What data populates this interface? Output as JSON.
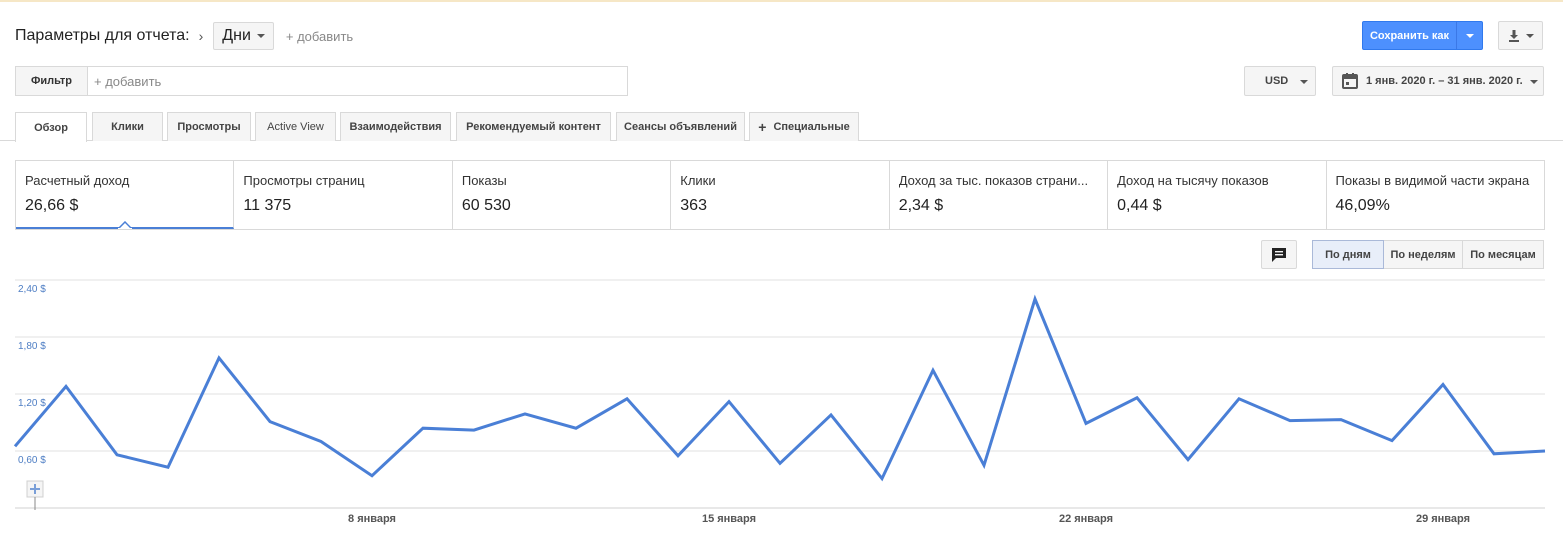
{
  "header": {
    "title": "Параметры для отчета:",
    "dimension": "Дни",
    "add_dimension": "+ добавить",
    "save_label": "Сохранить как"
  },
  "filter": {
    "label": "Фильтр",
    "placeholder": "+ добавить"
  },
  "currency": "USD",
  "date_range": "1 янв. 2020 г. – 31 янв. 2020 г.",
  "tabs": [
    {
      "label": "Обзор",
      "active": true
    },
    {
      "label": "Клики"
    },
    {
      "label": "Просмотры"
    },
    {
      "label": "Active View"
    },
    {
      "label": "Взаимодействия"
    },
    {
      "label": "Рекомендуемый контент"
    },
    {
      "label": "Сеансы объявлений"
    },
    {
      "label": "Специальные",
      "icon": "plus-icon"
    }
  ],
  "scorecards": [
    {
      "name": "Расчетный доход",
      "value": "26,66 $",
      "active": true
    },
    {
      "name": "Просмотры страниц",
      "value": "11 375"
    },
    {
      "name": "Показы",
      "value": "60 530"
    },
    {
      "name": "Клики",
      "value": "363"
    },
    {
      "name": "Доход за тыс. показов страни...",
      "value": "2,34 $"
    },
    {
      "name": "Доход на тысячу показов",
      "value": "0,44 $"
    },
    {
      "name": "Показы в видимой части экрана",
      "value": "46,09%"
    }
  ],
  "periods": [
    {
      "label": "По дням",
      "active": true
    },
    {
      "label": "По неделям"
    },
    {
      "label": "По месяцам"
    }
  ],
  "icons": {
    "download": "download-icon",
    "calendar": "calendar-icon",
    "comment": "comment-icon",
    "annotation_add": "plus-icon"
  },
  "colors": {
    "accent": "#4d90fe",
    "line": "#4a7fd6"
  },
  "chart_data": {
    "type": "line",
    "series": [
      {
        "values": [
          0.65,
          1.28,
          0.56,
          0.43,
          1.58,
          0.91,
          0.7,
          0.34,
          0.84,
          0.82,
          0.99,
          0.84,
          1.15,
          0.55,
          1.12,
          0.47,
          0.98,
          0.31,
          1.45,
          0.45,
          2.2,
          0.89,
          1.16,
          0.51,
          1.15,
          0.92,
          0.93,
          0.71,
          1.3,
          0.57,
          0.6
        ]
      }
    ],
    "x_labels": [
      "8 января",
      "15 января",
      "22 января",
      "29 января"
    ],
    "x_label_days": [
      8,
      15,
      22,
      29
    ],
    "y_ticks": [
      "2,40 $",
      "1,80 $",
      "1,20 $",
      "0,60 $"
    ],
    "y_tick_values": [
      2.4,
      1.8,
      1.2,
      0.6
    ],
    "ylim": [
      0,
      2.4
    ],
    "grid": true
  }
}
